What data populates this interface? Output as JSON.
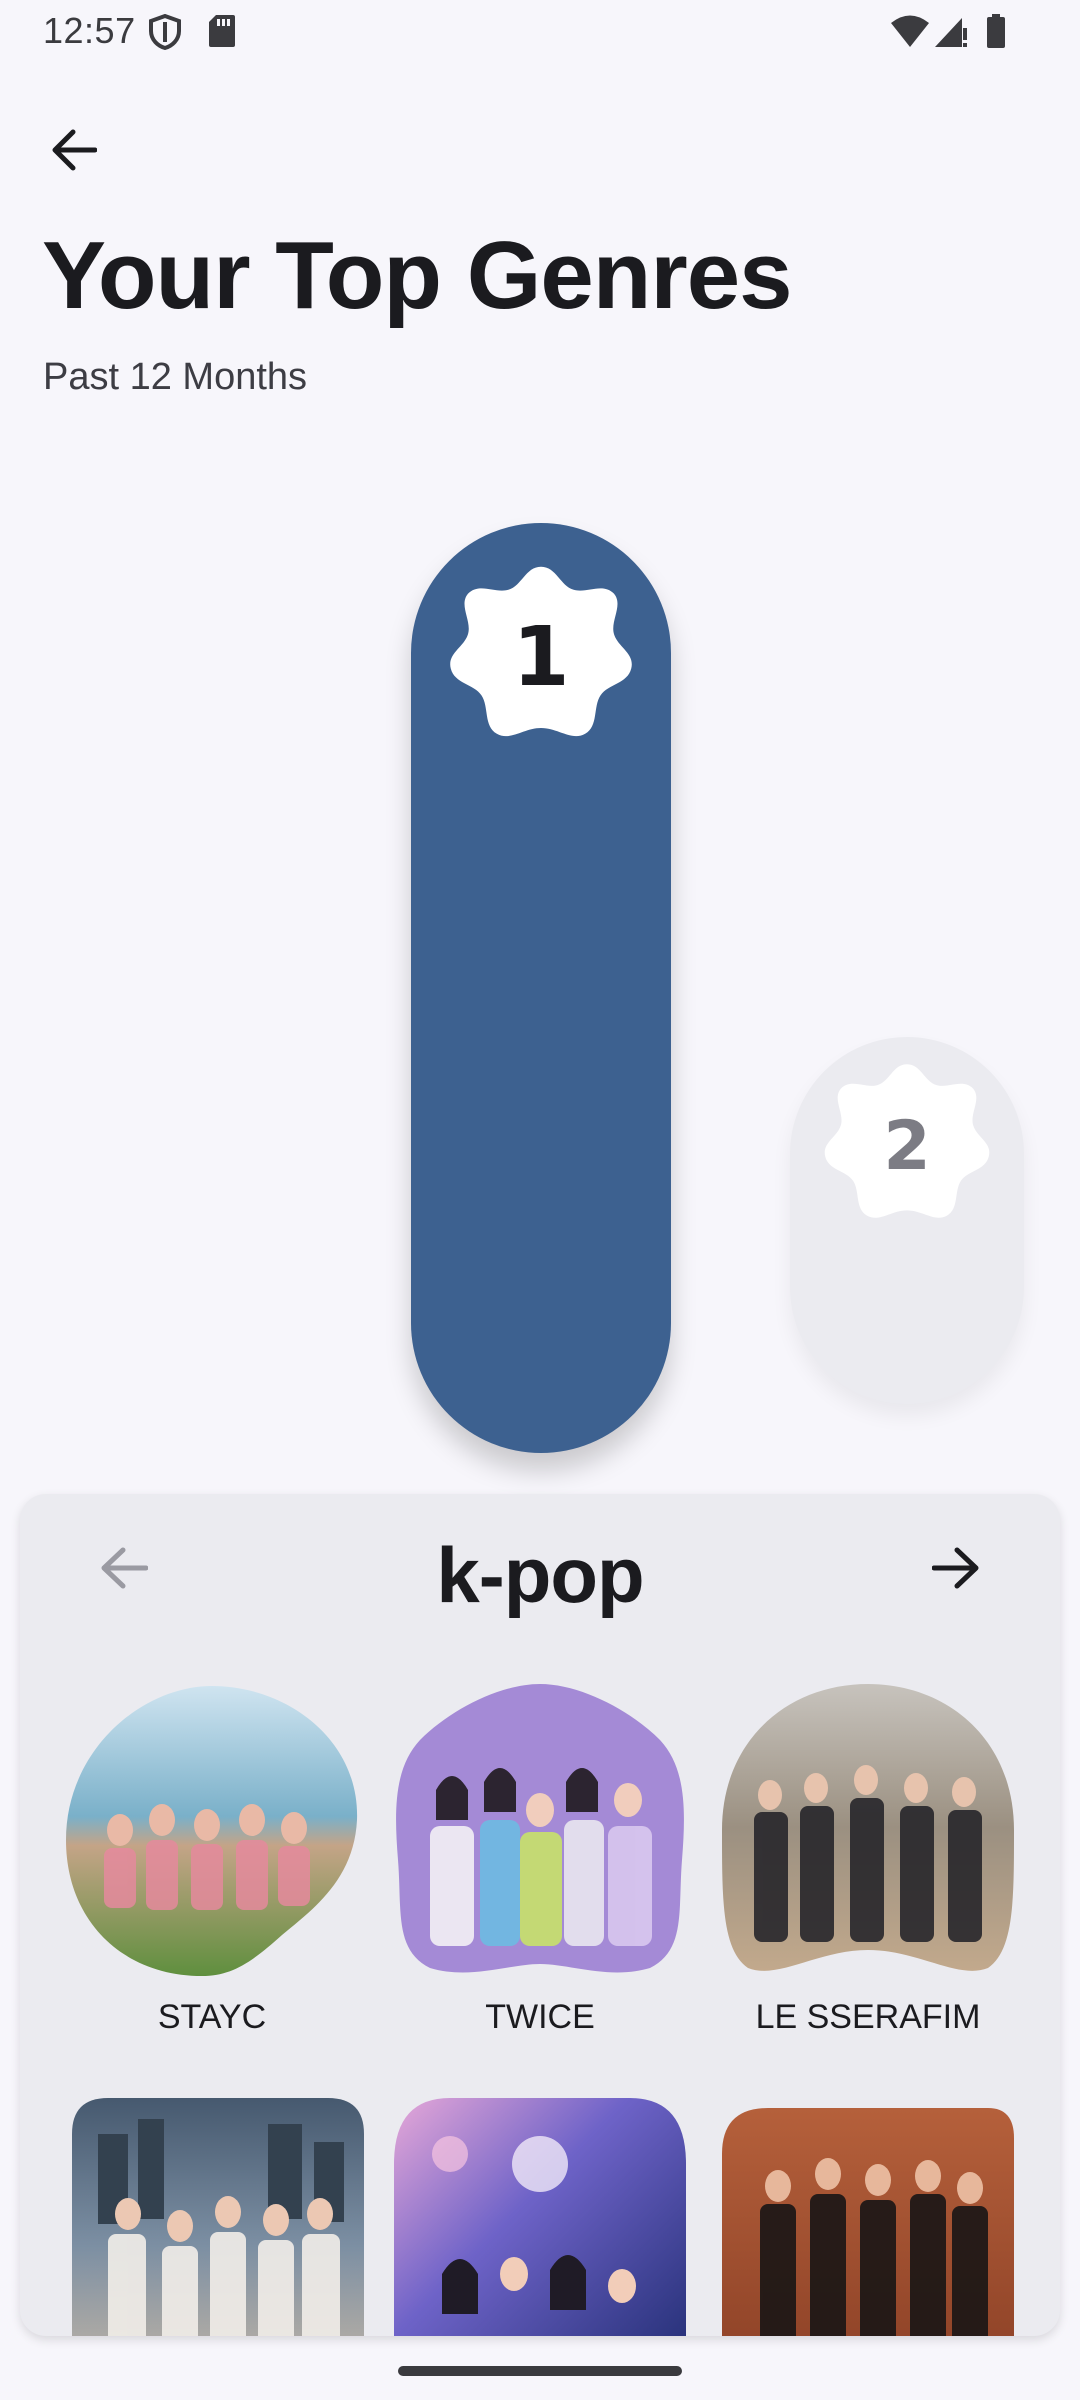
{
  "status_bar": {
    "time": "12:57",
    "icons": [
      "shield-icon",
      "sd-card-icon",
      "wifi-icon",
      "signal-icon",
      "battery-icon"
    ]
  },
  "app_bar": {
    "back_icon": "arrow-back-icon"
  },
  "header": {
    "title": "Your Top Genres",
    "subtitle": "Past 12 Months"
  },
  "ranking": {
    "bars": [
      {
        "rank": "1",
        "color": "#3d6190",
        "relative_height": 1.0
      },
      {
        "rank": "2",
        "color": "#ebebf0",
        "relative_height": 0.39
      }
    ]
  },
  "genre_card": {
    "genre": "k-pop",
    "prev_icon": "arrow-left-icon",
    "next_icon": "arrow-right-icon",
    "artists": [
      {
        "name": "STAYC"
      },
      {
        "name": "TWICE"
      },
      {
        "name": "LE SSERAFIM"
      },
      {
        "name": ""
      },
      {
        "name": ""
      },
      {
        "name": ""
      }
    ]
  },
  "colors": {
    "background": "#f7f6fb",
    "accent": "#3d6190",
    "card": "#ebebf0"
  }
}
